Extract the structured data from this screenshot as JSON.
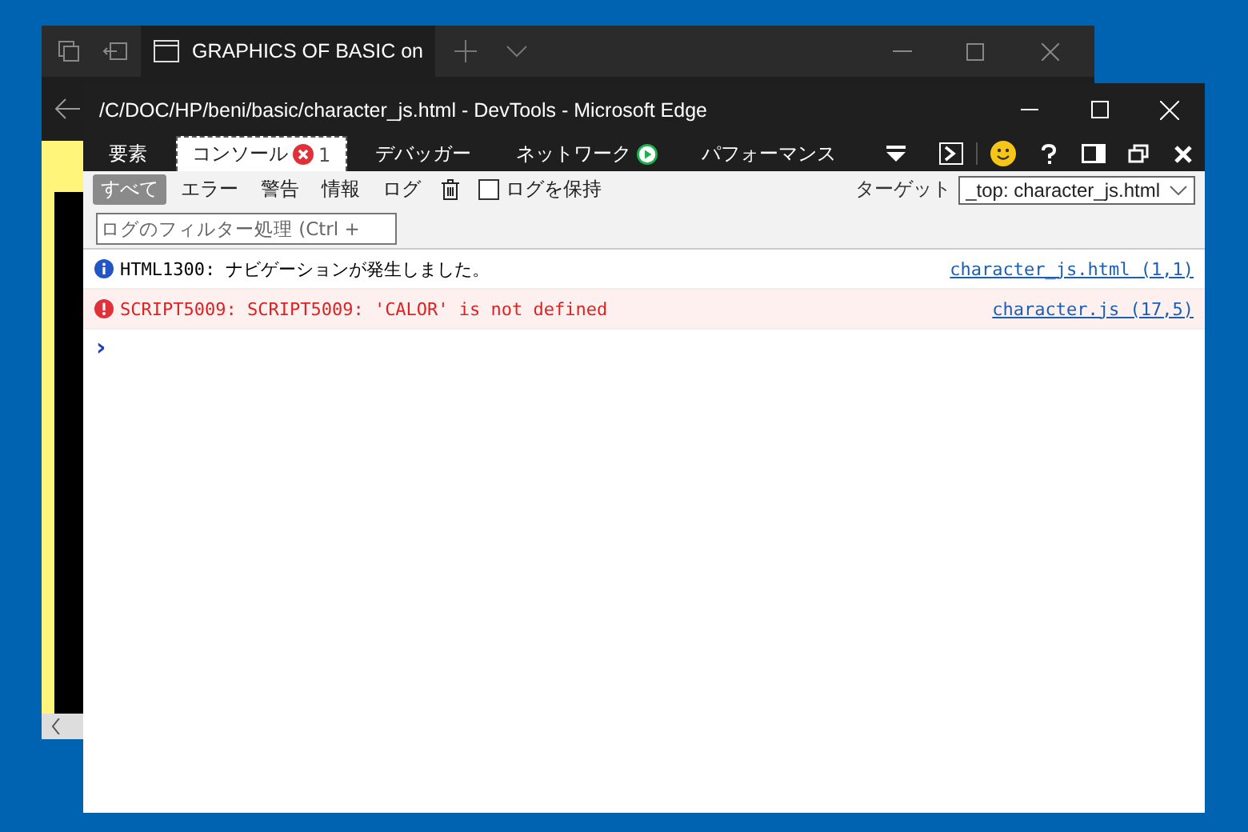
{
  "back_window": {
    "tab_title": "GRAPHICS OF BASIC on"
  },
  "devtools": {
    "title": "/C/DOC/HP/beni/basic/character_js.html - DevTools - Microsoft Edge",
    "tabs": [
      {
        "label": "要素",
        "selected": false,
        "kind": "plain"
      },
      {
        "label": "コンソール",
        "selected": true,
        "kind": "errors",
        "badge": "1"
      },
      {
        "label": "デバッガー",
        "selected": false,
        "kind": "plain"
      },
      {
        "label": "ネットワーク",
        "selected": false,
        "kind": "recording"
      },
      {
        "label": "パフォーマンス",
        "selected": false,
        "kind": "plain"
      }
    ],
    "filters": [
      {
        "label": "すべて",
        "selected": true
      },
      {
        "label": "エラー",
        "selected": false
      },
      {
        "label": "警告",
        "selected": false
      },
      {
        "label": "情報",
        "selected": false
      },
      {
        "label": "ログ",
        "selected": false
      }
    ],
    "preserve_log": {
      "label": "ログを保持",
      "checked": false
    },
    "target": {
      "label": "ターゲット",
      "value": "_top: character_js.html"
    },
    "filter_field": {
      "placeholder": "ログのフィルター処理 (Ctrl +"
    },
    "messages": [
      {
        "kind": "info",
        "text": "HTML1300: ナビゲーションが発生しました。",
        "source": "character_js.html (1,1)"
      },
      {
        "kind": "error",
        "text": "SCRIPT5009: SCRIPT5009: 'CALOR' is not defined",
        "source": "character.js (17,5)"
      }
    ],
    "prompt": "›"
  }
}
